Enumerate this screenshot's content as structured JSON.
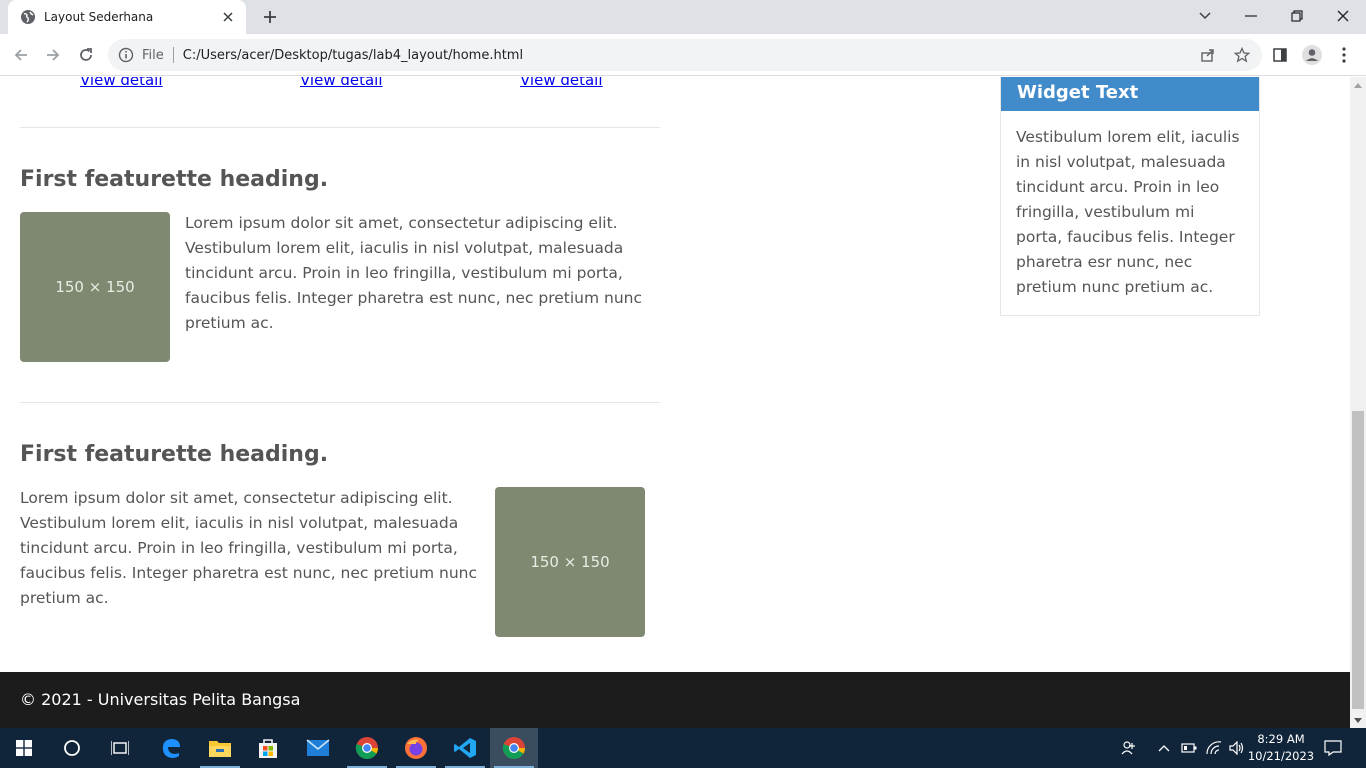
{
  "browser": {
    "tab_title": "Layout Sederhana",
    "scheme_label": "File",
    "url": "C:/Users/acer/Desktop/tugas/lab4_layout/home.html"
  },
  "content": {
    "view_links": [
      "View detail",
      "View detail",
      "View detail"
    ],
    "featurettes": [
      {
        "heading": "First featurette heading.",
        "image_label": "150 × 150",
        "text": "Lorem ipsum dolor sit amet, consectetur adipiscing elit. Vestibulum lorem elit, iaculis in nisl volutpat, malesuada tincidunt arcu. Proin in leo fringilla, vestibulum mi porta, faucibus felis. Integer pharetra est nunc, nec pretium nunc pretium ac."
      },
      {
        "heading": "First featurette heading.",
        "image_label": "150 × 150",
        "text": "Lorem ipsum dolor sit amet, consectetur adipiscing elit. Vestibulum lorem elit, iaculis in nisl volutpat, malesuada tincidunt arcu. Proin in leo fringilla, vestibulum mi porta, faucibus felis. Integer pharetra est nunc, nec pretium nunc pretium ac."
      }
    ],
    "widget": {
      "title": "Widget Text",
      "body": "Vestibulum lorem elit, iaculis in nisl volutpat, malesuada tincidunt arcu. Proin in leo fringilla, vestibulum mi porta, faucibus felis. Integer pharetra esr nunc, nec pretium nunc pretium ac."
    },
    "footer": "© 2021 - Universitas Pelita Bangsa"
  },
  "taskbar": {
    "time": "8:29 AM",
    "date": "10/21/2023",
    "apps": [
      "start-icon",
      "search-icon",
      "task-view-icon",
      "edge-icon",
      "file-explorer-icon",
      "store-icon",
      "mail-icon",
      "chrome-icon",
      "firefox-icon",
      "vscode-icon",
      "chrome-icon"
    ]
  },
  "colors": {
    "widget_header": "#428bca",
    "placeholder_image": "#7f8870",
    "footer_bg": "#1c1c1c",
    "taskbar_bg": "#10253a",
    "link": "#0000ee"
  }
}
